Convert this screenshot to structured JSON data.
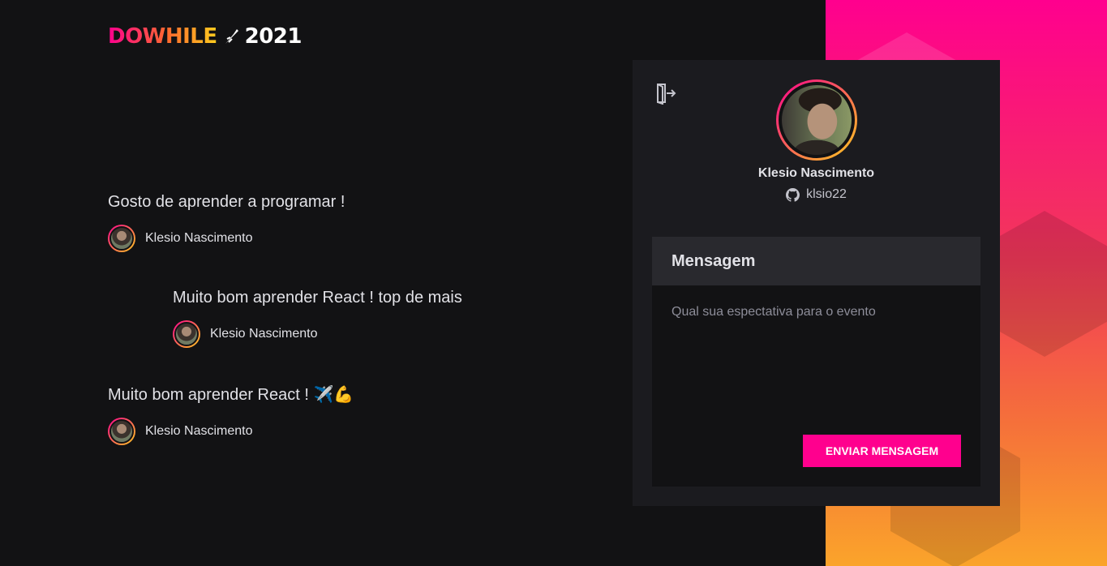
{
  "colors": {
    "background": "#121214",
    "panel": "#1b1b1f",
    "accent_pink": "#ff008e",
    "accent_yellow": "#ffcd1e"
  },
  "logo": {
    "text": "DOWHILE",
    "year": "2021",
    "icon": "rocket-icon"
  },
  "messages": [
    {
      "content": "Gosto de aprender a programar !",
      "user": "Klesio Nascimento"
    },
    {
      "content": "Muito bom aprender React ! top de mais",
      "user": "Klesio Nascimento"
    },
    {
      "content": "Muito bom aprender React ! ✈️💪",
      "user": "Klesio Nascimento"
    }
  ],
  "profile": {
    "signout_icon": "sign-out-icon",
    "name": "Klesio Nascimento",
    "login": "klsio22",
    "login_icon": "github-icon"
  },
  "form": {
    "title": "Mensagem",
    "placeholder": "Qual sua espectativa para o evento",
    "value": "",
    "submit_label": "ENVIAR MENSAGEM"
  }
}
